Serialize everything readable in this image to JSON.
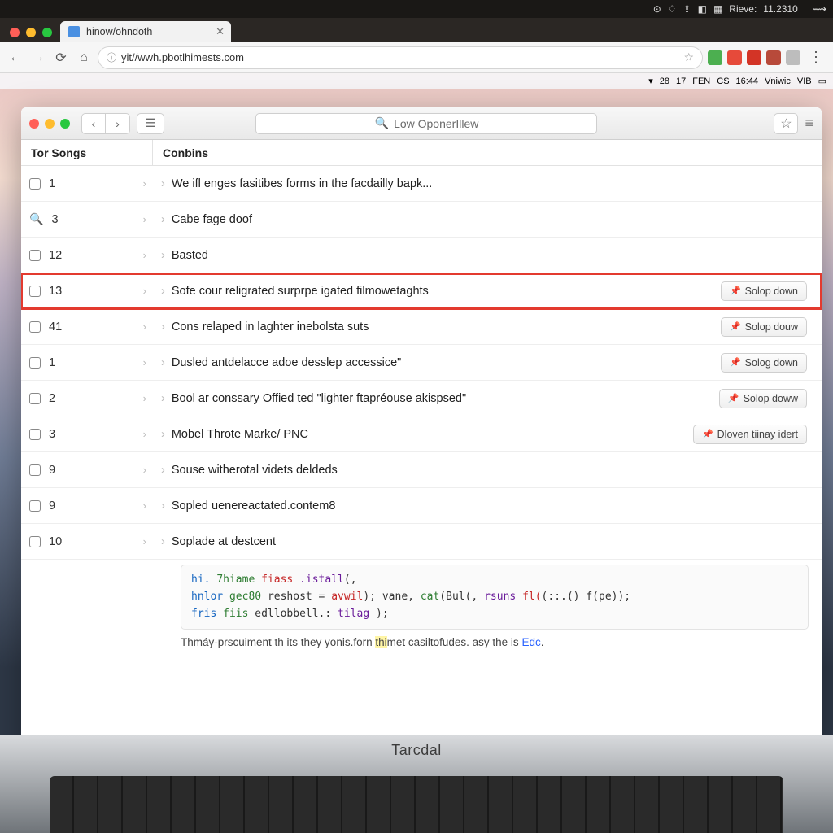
{
  "menubar": {
    "clock_label": "Rieve:",
    "clock_time": "11.2310"
  },
  "chrome": {
    "tab_title": "hinow/ohndoth",
    "url": "yit//wwh.pbotlhimests.com"
  },
  "inner_menubar": {
    "items": [
      "28",
      "17",
      "FEN",
      "CS",
      "16:44",
      "Vniwic",
      "VIB"
    ]
  },
  "inner_window": {
    "search_placeholder": "Low OponerIllew",
    "columns": {
      "left": "Tor Songs",
      "right": "Conbins"
    },
    "rows": [
      {
        "icon": "checkbox",
        "num": "1",
        "text": "We ifl enges fasitibes forms in the facdailly bapk...",
        "btn": null,
        "highlight": false
      },
      {
        "icon": "search",
        "num": "3",
        "text": "Cabe fage doof",
        "btn": null,
        "highlight": false
      },
      {
        "icon": "checkbox",
        "num": "12",
        "text": "Basted",
        "btn": null,
        "highlight": false
      },
      {
        "icon": "checkbox",
        "num": "13",
        "text": "Sofe cour religrated surprpe igated filmowetaghts",
        "btn": "Solop down",
        "highlight": true
      },
      {
        "icon": "checkbox",
        "num": "41",
        "text": "Cons relaped in laghter inebolsta suts",
        "btn": "Solop douw",
        "highlight": false
      },
      {
        "icon": "checkbox",
        "num": "1",
        "text": "Dusled antdelacce adoe desslep accessice\"",
        "btn": "Solog down",
        "highlight": false
      },
      {
        "icon": "checkbox",
        "num": "2",
        "text": "Bool ar conssary Offied ted \"lighter ftapréouse akispsed\"",
        "btn": "Solop doww",
        "highlight": false
      },
      {
        "icon": "checkbox",
        "num": "3",
        "text": "Mobel Throte Marke/ PNC",
        "btn": "Dloven tiinay idert",
        "highlight": false
      },
      {
        "icon": "checkbox",
        "num": "9",
        "text": "Souse witherotal videts deldeds",
        "btn": null,
        "highlight": false
      },
      {
        "icon": "checkbox",
        "num": "9",
        "text": "Sopled uenereactated.contem8",
        "btn": null,
        "highlight": false
      },
      {
        "icon": "checkbox",
        "num": "10",
        "text": "Soplade at destcent",
        "btn": null,
        "highlight": false
      }
    ],
    "code": {
      "l1a": "hi.",
      "l1b": "7hiame",
      "l1c": "fiass",
      "l1d": ".istall",
      "l1e": "(,",
      "l2a": "hnlor",
      "l2b": "gec80",
      "l2c": "reshost =",
      "l2d": "avwil",
      "l2e": ");  vane,",
      "l2f": "cat",
      "l2g": "(Bul(,",
      "l2h": "rsuns",
      "l2i": "fl(",
      "l2j": "(::.()  f(pe));",
      "l3a": "fris",
      "l3b": "fiis",
      "l3c": "edllobbell.:",
      "l3d": "tilag",
      "l3e": ");"
    },
    "bodytext": {
      "pre": "Thmáy-prscuiment th its they yonis.forn ",
      "hl": "thi",
      "mid": "met casiltofudes. asy the is ",
      "link": "Edc",
      "post": "."
    }
  },
  "laptop_label": "Tarcdal"
}
